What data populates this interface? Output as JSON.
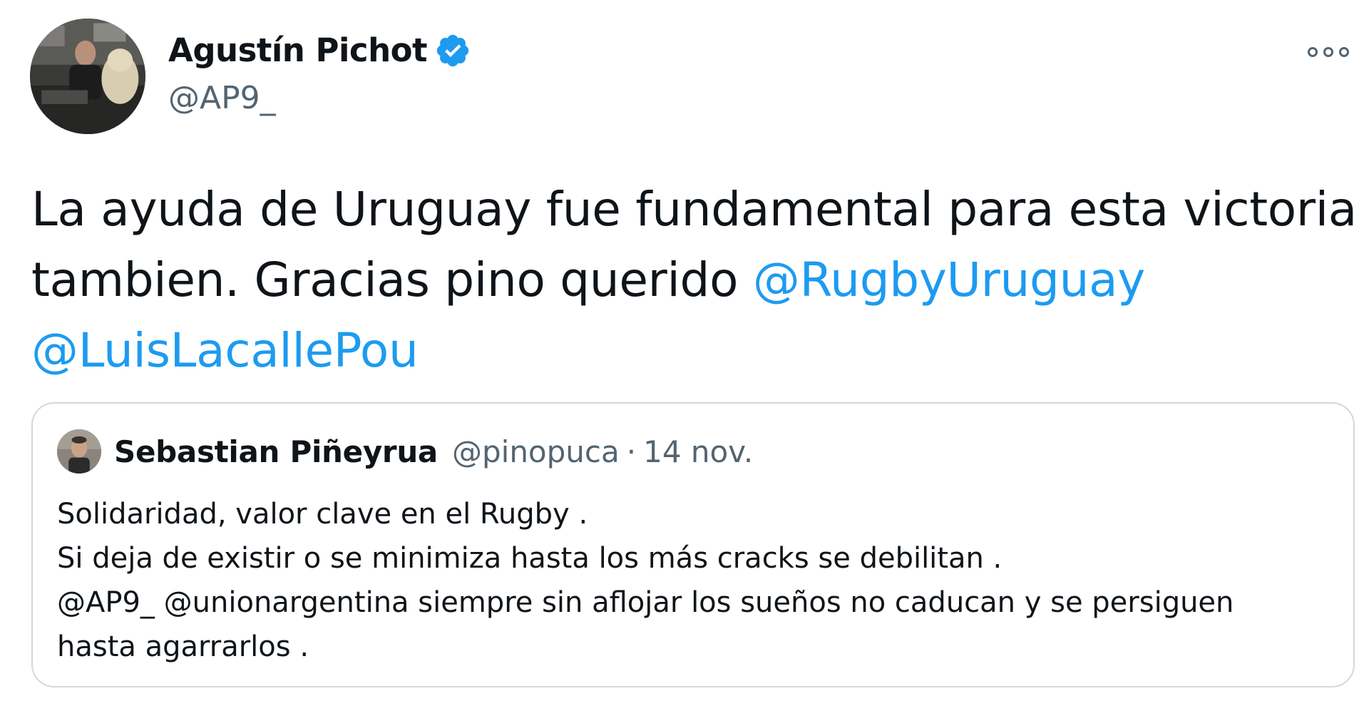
{
  "author": {
    "display_name": "Agustín Pichot",
    "handle": "@AP9_",
    "verified": true
  },
  "tweet": {
    "line1": "La ayuda de Uruguay fue fundamental para esta victoria",
    "line2_text": "tambien. Gracias pino querido ",
    "mention1": "@RugbyUruguay",
    "mention2": "@LuisLacallePou"
  },
  "quoted_tweet": {
    "display_name": "Sebastian Piñeyrua",
    "handle": "@pinopuca",
    "separator": "·",
    "date": "14 nov.",
    "lines": [
      "Solidaridad, valor clave en el Rugby .",
      "Si deja de existir o se minimiza hasta los más cracks se debilitan .",
      "@AP9_ @unionargentina siempre sin aflojar los sueños no caducan y se persiguen",
      "hasta agarrarlos ."
    ]
  },
  "icons": {
    "verified": "verified-badge-icon",
    "more": "more-options-icon"
  },
  "colors": {
    "mention": "#1d9bf0",
    "secondary_text": "#536471",
    "border": "#cfd9de"
  }
}
